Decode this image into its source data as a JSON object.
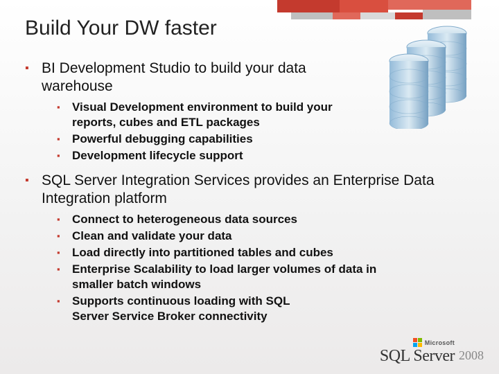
{
  "title": "Build Your DW faster",
  "items": [
    {
      "text": "BI Development Studio to build your data warehouse",
      "width_css": "max-width:420px",
      "sub": [
        {
          "text": "Visual Development environment to build your reports, cubes and ETL packages",
          "width_css": "max-width:430px"
        },
        {
          "text": "Powerful debugging capabilities"
        },
        {
          "text": "Development lifecycle support"
        }
      ]
    },
    {
      "text": "SQL Server Integration Services provides an Enterprise Data Integration platform",
      "sub": [
        {
          "text": "Connect to heterogeneous data sources"
        },
        {
          "text": "Clean and validate your data"
        },
        {
          "text": "Load directly into partitioned tables and cubes"
        },
        {
          "text": "Enterprise Scalability to load larger volumes of data in smaller batch windows",
          "width_css": "max-width:440px"
        },
        {
          "text": "Supports continuous loading with SQL Server Service Broker connectivity",
          "width_css": "max-width:360px"
        }
      ]
    }
  ],
  "footer": {
    "microsoft": "Microsoft",
    "product": "SQL Server",
    "year": "2008"
  }
}
